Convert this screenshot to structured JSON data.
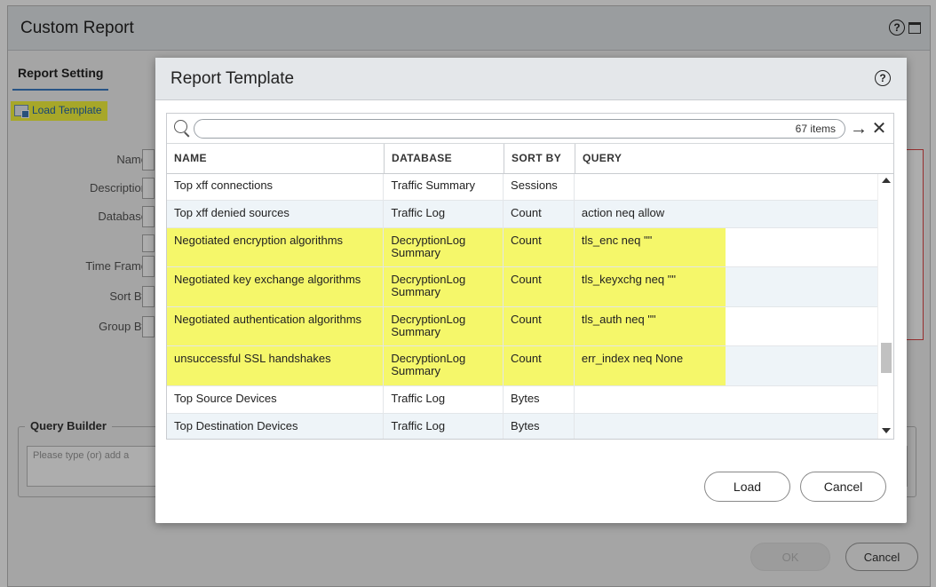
{
  "background_dialog": {
    "title": "Custom Report",
    "tab": "Report Setting",
    "load_template": "Load Template",
    "labels": {
      "name": "Name",
      "description": "Description",
      "database": "Database",
      "time_frame": "Time Frame",
      "sort_by": "Sort By",
      "group_by": "Group By"
    },
    "query_builder": {
      "legend": "Query Builder",
      "placeholder": "Please type (or) add a"
    },
    "ok_label": "OK",
    "cancel_label": "Cancel"
  },
  "modal": {
    "title": "Report Template",
    "search": {
      "placeholder": "",
      "count": "67 items"
    },
    "columns": [
      "NAME",
      "DATABASE",
      "SORT BY",
      "QUERY"
    ],
    "rows": [
      {
        "name": "Top xff connections",
        "database": "Traffic Summary",
        "sort_by": "Sessions",
        "query": "",
        "highlighted": false
      },
      {
        "name": "Top xff denied sources",
        "database": "Traffic Log",
        "sort_by": "Count",
        "query": "action neq allow",
        "highlighted": false
      },
      {
        "name": "Negotiated encryption algorithms",
        "database": "DecryptionLog Summary",
        "sort_by": "Count",
        "query": "tls_enc neq \"\"",
        "highlighted": true
      },
      {
        "name": "Negotiated key exchange algorithms",
        "database": "DecryptionLog Summary",
        "sort_by": "Count",
        "query": "tls_keyxchg neq \"\"",
        "highlighted": true
      },
      {
        "name": "Negotiated authentication algorithms",
        "database": "DecryptionLog Summary",
        "sort_by": "Count",
        "query": "tls_auth neq \"\"",
        "highlighted": true
      },
      {
        "name": "unsuccessful SSL handshakes",
        "database": "DecryptionLog Summary",
        "sort_by": "Count",
        "query": "err_index neq None",
        "highlighted": true
      },
      {
        "name": "Top Source Devices",
        "database": "Traffic Log",
        "sort_by": "Bytes",
        "query": "",
        "highlighted": false
      },
      {
        "name": "Top Destination Devices",
        "database": "Traffic Log",
        "sort_by": "Bytes",
        "query": "",
        "highlighted": false
      }
    ],
    "load_label": "Load",
    "cancel_label": "Cancel"
  },
  "colors": {
    "highlight": "#f5f76a",
    "header_bg": "#e4e7ea",
    "link_blue": "#1f63b0"
  },
  "icons": [
    "help-icon",
    "window-icon",
    "template-icon",
    "search-icon",
    "arrow-right-icon",
    "close-icon",
    "scroll-up-icon",
    "scroll-down-icon"
  ]
}
